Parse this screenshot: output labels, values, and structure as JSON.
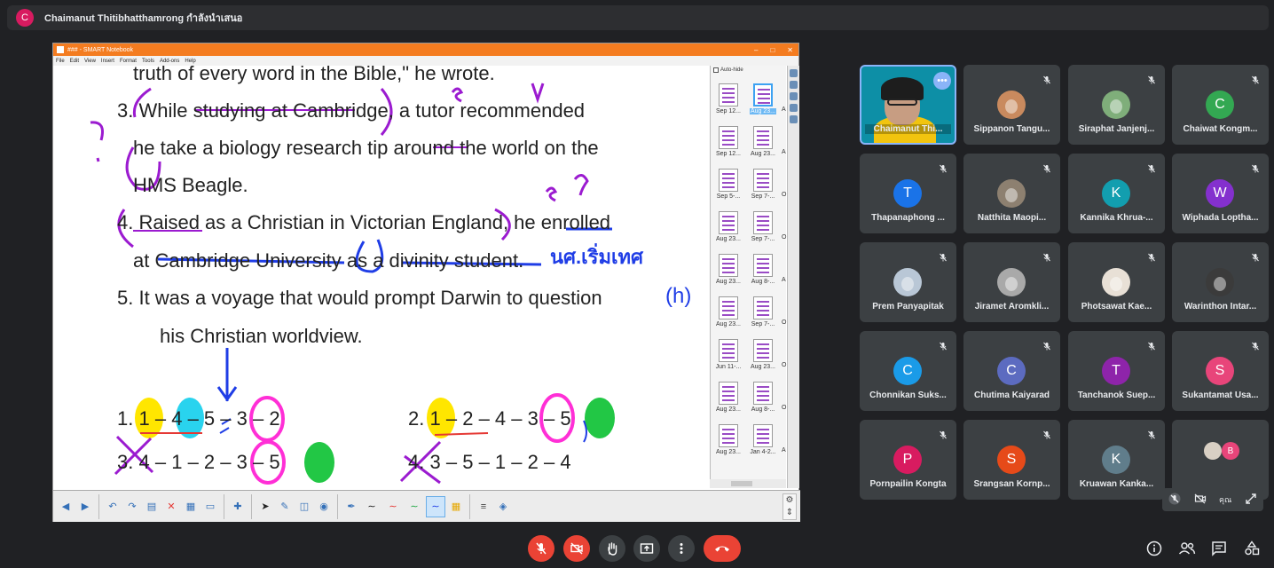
{
  "presenter": {
    "initial": "C",
    "label": "Chaimanut Thitibhatthamrong กำลังนำเสนอ"
  },
  "share_window": {
    "title": "### - SMART Notebook",
    "menu": [
      "File",
      "Edit",
      "View",
      "Insert",
      "Format",
      "Tools",
      "Add-ons",
      "Help"
    ],
    "slide_lines": [
      "truth of every word in the Bible,\" he wrote.",
      "3. While studying at Cambridge, a tutor recommended",
      "he take a biology research tip around the world on the",
      "HMS Beagle.",
      "4. Raised as a Christian in Victorian England, he enrolled",
      "at Cambridge University as a divinity student.",
      "5. It was a voyage that would prompt Darwin to question",
      "his Christian worldview."
    ],
    "sequences": {
      "s1": {
        "prefix": "1.",
        "items": [
          "1",
          "4",
          "5",
          "3",
          "2"
        ]
      },
      "s2": {
        "prefix": "2.",
        "items": [
          "1",
          "2",
          "4",
          "3",
          "5"
        ]
      },
      "s3": {
        "prefix": "3.",
        "items": [
          "4",
          "1",
          "2",
          "3",
          "5"
        ]
      },
      "s4": {
        "prefix": "4.",
        "items": [
          "3",
          "5",
          "1",
          "2",
          "4"
        ]
      }
    },
    "handwriting": {
      "thai": "นศ.เริ่มเทศ",
      "paren_h": "(h)"
    },
    "autohide_label": "Auto-hide",
    "thumbnails": [
      [
        "Sep 12...",
        "Aug 23..."
      ],
      [
        "Sep 12...",
        "Aug 23..."
      ],
      [
        "Sep 5-...",
        "Sep 7-..."
      ],
      [
        "Aug 23...",
        "Sep 7-..."
      ],
      [
        "Aug 23...",
        "Aug 8-..."
      ],
      [
        "Aug 23...",
        "Sep 7-..."
      ],
      [
        "Jun 11-...",
        "Aug 23..."
      ],
      [
        "Aug 23...",
        "Aug 8-..."
      ],
      [
        "Aug 23...",
        "Jan 4-2..."
      ]
    ],
    "thumb_third": [
      "A",
      "A",
      "O",
      "O",
      "A",
      "O",
      "O",
      "O",
      "A"
    ]
  },
  "participants": [
    {
      "name": "Chaimanut Thi...",
      "self": true
    },
    {
      "name": "Sippanon Tangu...",
      "kind": "photo",
      "tone": "#c98a5e"
    },
    {
      "name": "Siraphat Janjenj...",
      "kind": "photo",
      "tone": "#7fae7a"
    },
    {
      "name": "Chaiwat Kongm...",
      "initial": "C",
      "color": "#33a852"
    },
    {
      "name": "Thapanaphong ...",
      "initial": "T",
      "color": "#1a73e8"
    },
    {
      "name": "Natthita Maopi...",
      "kind": "photo",
      "tone": "#8d8070"
    },
    {
      "name": "Kannika Khrua-...",
      "initial": "K",
      "color": "#129eaf"
    },
    {
      "name": "Wiphada Loptha...",
      "initial": "W",
      "color": "#8430ce"
    },
    {
      "name": "Prem Panyapitak",
      "kind": "photo",
      "tone": "#b9c7d6"
    },
    {
      "name": "Jiramet Aromkli...",
      "kind": "photo",
      "tone": "#a9a9a9"
    },
    {
      "name": "Photsawat Kae...",
      "kind": "photo",
      "tone": "#e8e0d6"
    },
    {
      "name": "Warinthon Intar...",
      "kind": "photo",
      "tone": "#3b3b3b"
    },
    {
      "name": "Chonnikan Suks...",
      "initial": "C",
      "color": "#1a9be8"
    },
    {
      "name": "Chutima Kaiyarad",
      "initial": "C",
      "color": "#5c6bc0"
    },
    {
      "name": "Tanchanok Suep...",
      "initial": "T",
      "color": "#8e24aa"
    },
    {
      "name": "Sukantamat Usa...",
      "initial": "S",
      "color": "#e8457a"
    },
    {
      "name": "Pornpailin Kongta",
      "initial": "P",
      "color": "#d81b60"
    },
    {
      "name": "Srangsan Kornp...",
      "initial": "S",
      "color": "#e64a19"
    },
    {
      "name": "Kruawan Kanka...",
      "initial": "K",
      "color": "#607d8b"
    }
  ],
  "overflow": {
    "initial": "B"
  },
  "self_controls": {
    "label": "คุณ"
  },
  "colors": {
    "bg": "#202124",
    "tile": "#3c4043",
    "red": "#ea4335",
    "accent": "#8ab4f8"
  }
}
